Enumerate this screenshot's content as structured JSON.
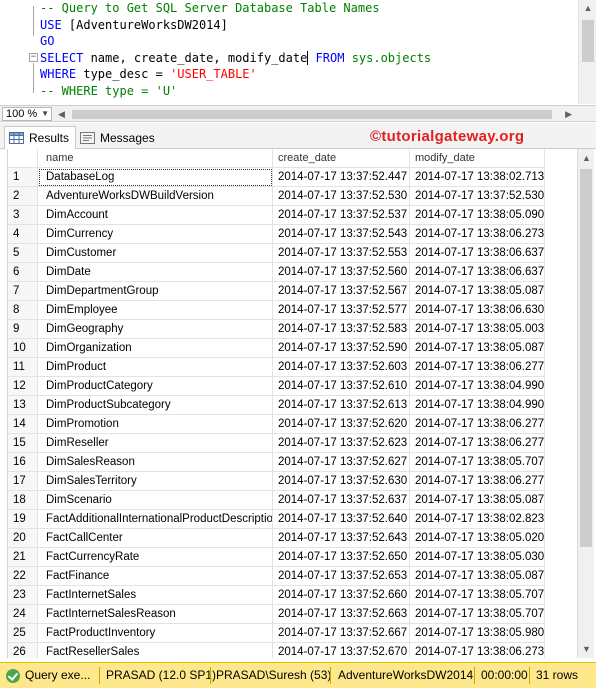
{
  "editor": {
    "lines": [
      [
        {
          "t": "-- Query to Get SQL Server Database Table Names",
          "c": "c-comment"
        }
      ],
      [
        {
          "t": "USE ",
          "c": "c-kw"
        },
        {
          "t": "[AdventureWorksDW2014]",
          "c": "c-plain"
        }
      ],
      [
        {
          "t": "GO",
          "c": "c-kw"
        }
      ],
      [
        {
          "t": "SELECT ",
          "c": "c-kw"
        },
        {
          "t": "name, create_date, modify_date",
          "c": "c-plain"
        },
        {
          "t": "|",
          "c": "cursor"
        },
        {
          "t": " FROM ",
          "c": "c-kw"
        },
        {
          "t": "sys.objects",
          "c": "c-sys"
        }
      ],
      [
        {
          "t": "WHERE ",
          "c": "c-kw"
        },
        {
          "t": "type_desc = ",
          "c": "c-plain"
        },
        {
          "t": "'USER_TABLE'",
          "c": "c-str"
        }
      ],
      [
        {
          "t": "-- WHERE type = 'U'",
          "c": "c-comment"
        }
      ]
    ]
  },
  "zoom": {
    "value": "100 %"
  },
  "tabs": {
    "results": "Results",
    "messages": "Messages"
  },
  "brand": "©tutorialgateway.org",
  "grid": {
    "headers": [
      "name",
      "create_date",
      "modify_date"
    ],
    "rows": [
      [
        "1",
        "DatabaseLog",
        "2014-07-17 13:37:52.447",
        "2014-07-17 13:38:02.713"
      ],
      [
        "2",
        "AdventureWorksDWBuildVersion",
        "2014-07-17 13:37:52.530",
        "2014-07-17 13:37:52.530"
      ],
      [
        "3",
        "DimAccount",
        "2014-07-17 13:37:52.537",
        "2014-07-17 13:38:05.090"
      ],
      [
        "4",
        "DimCurrency",
        "2014-07-17 13:37:52.543",
        "2014-07-17 13:38:06.273"
      ],
      [
        "5",
        "DimCustomer",
        "2014-07-17 13:37:52.553",
        "2014-07-17 13:38:06.637"
      ],
      [
        "6",
        "DimDate",
        "2014-07-17 13:37:52.560",
        "2014-07-17 13:38:06.637"
      ],
      [
        "7",
        "DimDepartmentGroup",
        "2014-07-17 13:37:52.567",
        "2014-07-17 13:38:05.087"
      ],
      [
        "8",
        "DimEmployee",
        "2014-07-17 13:37:52.577",
        "2014-07-17 13:38:06.630"
      ],
      [
        "9",
        "DimGeography",
        "2014-07-17 13:37:52.583",
        "2014-07-17 13:38:05.003"
      ],
      [
        "10",
        "DimOrganization",
        "2014-07-17 13:37:52.590",
        "2014-07-17 13:38:05.087"
      ],
      [
        "11",
        "DimProduct",
        "2014-07-17 13:37:52.603",
        "2014-07-17 13:38:06.277"
      ],
      [
        "12",
        "DimProductCategory",
        "2014-07-17 13:37:52.610",
        "2014-07-17 13:38:04.990"
      ],
      [
        "13",
        "DimProductSubcategory",
        "2014-07-17 13:37:52.613",
        "2014-07-17 13:38:04.990"
      ],
      [
        "14",
        "DimPromotion",
        "2014-07-17 13:37:52.620",
        "2014-07-17 13:38:06.277"
      ],
      [
        "15",
        "DimReseller",
        "2014-07-17 13:37:52.623",
        "2014-07-17 13:38:06.277"
      ],
      [
        "16",
        "DimSalesReason",
        "2014-07-17 13:37:52.627",
        "2014-07-17 13:38:05.707"
      ],
      [
        "17",
        "DimSalesTerritory",
        "2014-07-17 13:37:52.630",
        "2014-07-17 13:38:06.277"
      ],
      [
        "18",
        "DimScenario",
        "2014-07-17 13:37:52.637",
        "2014-07-17 13:38:05.087"
      ],
      [
        "19",
        "FactAdditionalInternationalProductDescription",
        "2014-07-17 13:37:52.640",
        "2014-07-17 13:38:02.823"
      ],
      [
        "20",
        "FactCallCenter",
        "2014-07-17 13:37:52.643",
        "2014-07-17 13:38:05.020"
      ],
      [
        "21",
        "FactCurrencyRate",
        "2014-07-17 13:37:52.650",
        "2014-07-17 13:38:05.030"
      ],
      [
        "22",
        "FactFinance",
        "2014-07-17 13:37:52.653",
        "2014-07-17 13:38:05.087"
      ],
      [
        "23",
        "FactInternetSales",
        "2014-07-17 13:37:52.660",
        "2014-07-17 13:38:05.707"
      ],
      [
        "24",
        "FactInternetSalesReason",
        "2014-07-17 13:37:52.663",
        "2014-07-17 13:38:05.707"
      ],
      [
        "25",
        "FactProductInventory",
        "2014-07-17 13:37:52.667",
        "2014-07-17 13:38:05.980"
      ],
      [
        "26",
        "FactResellerSales",
        "2014-07-17 13:37:52.670",
        "2014-07-17 13:38:06.273"
      ]
    ]
  },
  "status": {
    "icon": "check-circle-icon",
    "message": "Query exe...",
    "server": "PRASAD (12.0 SP1)",
    "user": "PRASAD\\Suresh (53)",
    "database": "AdventureWorksDW2014",
    "elapsed": "00:00:00",
    "rows": "31 rows"
  },
  "colors": {
    "status_bar": "#ffe88c",
    "keyword": "#0000ff",
    "comment": "#008000",
    "string": "#ff0000",
    "brand": "#e12020"
  }
}
